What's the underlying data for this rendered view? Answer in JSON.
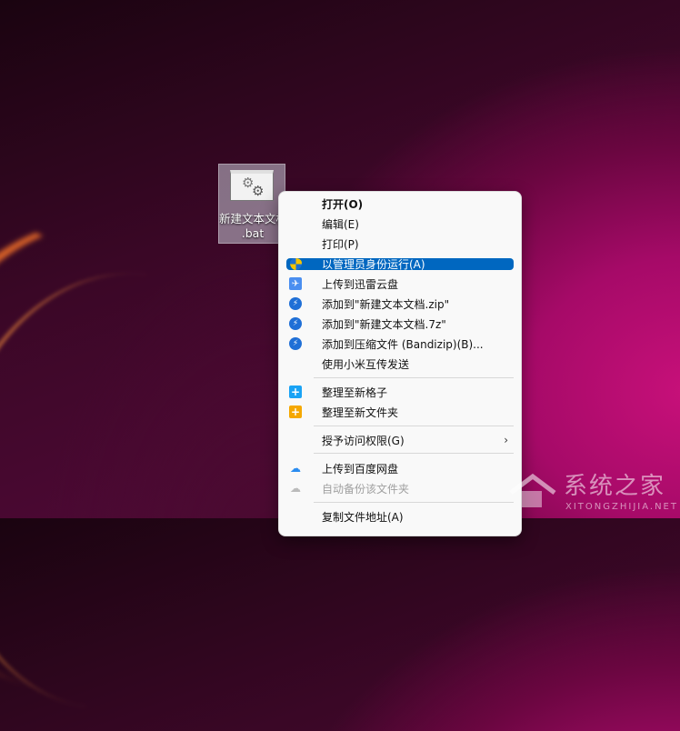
{
  "desktop_icon": {
    "name_line1": "新建文本文档",
    "name_line2": ".bat"
  },
  "menu": {
    "items": [
      {
        "label": "打开(O)",
        "icon": "none",
        "style": "bold"
      },
      {
        "label": "编辑(E)",
        "icon": "none"
      },
      {
        "label": "打印(P)",
        "icon": "none"
      },
      {
        "label": "以管理员身份运行(A)",
        "icon": "uac-shield-icon",
        "style": "selected"
      },
      {
        "label": "上传到迅雷云盘",
        "icon": "xunlei-icon"
      },
      {
        "label": "添加到\"新建文本文档.zip\"",
        "icon": "bandizip-icon"
      },
      {
        "label": "添加到\"新建文本文档.7z\"",
        "icon": "bandizip-icon"
      },
      {
        "label": "添加到压缩文件 (Bandizip)(B)...",
        "icon": "bandizip-icon"
      },
      {
        "label": "使用小米互传发送",
        "icon": "none"
      },
      {
        "label": "整理至新格子",
        "icon": "new-grid-icon"
      },
      {
        "label": "整理至新文件夹",
        "icon": "new-folder-icon"
      },
      {
        "label": "授予访问权限(G)",
        "icon": "none",
        "submenu": true
      },
      {
        "label": "上传到百度网盘",
        "icon": "baidu-netdisk-icon"
      },
      {
        "label": "自动备份该文件夹",
        "icon": "baidu-netdisk-icon",
        "style": "disabled"
      },
      {
        "label": "复制文件地址(A)",
        "icon": "none"
      }
    ]
  },
  "watermark": {
    "text": "系统之家",
    "url_text": "XITONGZHIJIA.NET"
  },
  "colors": {
    "accent": "#0067c0",
    "menu_bg": "#f9f9f9"
  }
}
